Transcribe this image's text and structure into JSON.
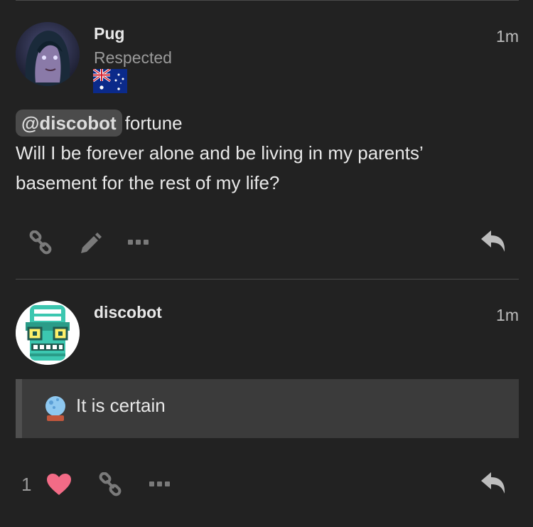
{
  "posts": [
    {
      "username": "Pug",
      "user_title": "Respected",
      "time": "1m",
      "flag": "australia-flag",
      "mention": "@discobot",
      "command": "fortune",
      "text": "Will I be forever alone and be living in my parents’ basement for the rest of my life?"
    },
    {
      "username": "discobot",
      "time": "1m",
      "quote_text": "It is certain",
      "quote_icon": "crystal-ball-icon",
      "like_count": "1"
    }
  ],
  "icons": [
    "link-icon",
    "pencil-icon",
    "more-icon",
    "reply-icon",
    "heart-icon",
    "crystal-ball-icon"
  ],
  "colors": {
    "background": "#222222",
    "heart": "#f26b86",
    "quote_bg": "#3b3b3b"
  }
}
